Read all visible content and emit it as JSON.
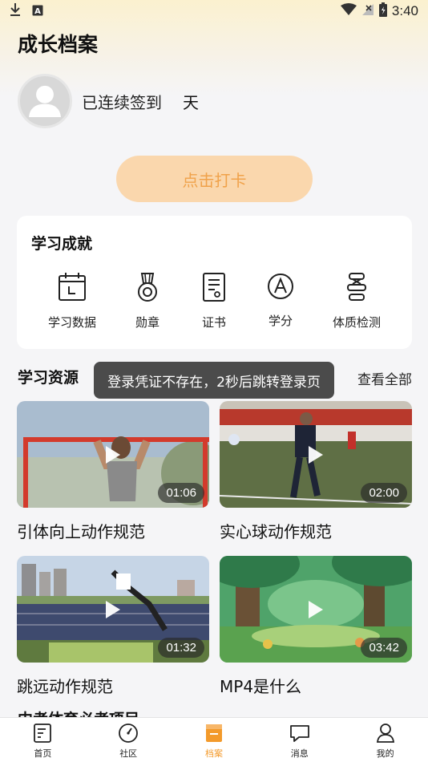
{
  "status_bar": {
    "time": "3:40"
  },
  "page": {
    "title": "成长档案"
  },
  "profile": {
    "checkin_text": "已连续签到",
    "checkin_days": "",
    "checkin_unit": "天"
  },
  "punch_button": {
    "label": "点击打卡"
  },
  "achievements": {
    "title": "学习成就",
    "items": [
      {
        "label": "学习数据",
        "icon": "calendar-icon"
      },
      {
        "label": "勋章",
        "icon": "medal-icon"
      },
      {
        "label": "证书",
        "icon": "certificate-icon"
      },
      {
        "label": "学分",
        "icon": "credit-icon"
      },
      {
        "label": "体质检测",
        "icon": "fitness-test-icon"
      }
    ]
  },
  "resources": {
    "title": "学习资源",
    "view_all": "查看全部",
    "videos": [
      {
        "title": "引体向上动作规范",
        "duration": "01:06"
      },
      {
        "title": "实心球动作规范",
        "duration": "02:00"
      },
      {
        "title": "跳远动作规范",
        "duration": "01:32"
      },
      {
        "title": "MP4是什么",
        "duration": "03:42"
      }
    ],
    "next_section_title": "中考体育必考项目"
  },
  "toast": {
    "message": "登录凭证不存在，2秒后跳转登录页"
  },
  "tabbar": {
    "items": [
      {
        "label": "首页",
        "icon": "home-icon"
      },
      {
        "label": "社区",
        "icon": "compass-icon"
      },
      {
        "label": "档案",
        "icon": "archive-icon"
      },
      {
        "label": "消息",
        "icon": "message-icon"
      },
      {
        "label": "我的",
        "icon": "user-icon"
      }
    ],
    "active_index": 2
  },
  "colors": {
    "accent": "#f39a2b",
    "button_bg": "#fad7ad",
    "button_text": "#f0a24a"
  }
}
